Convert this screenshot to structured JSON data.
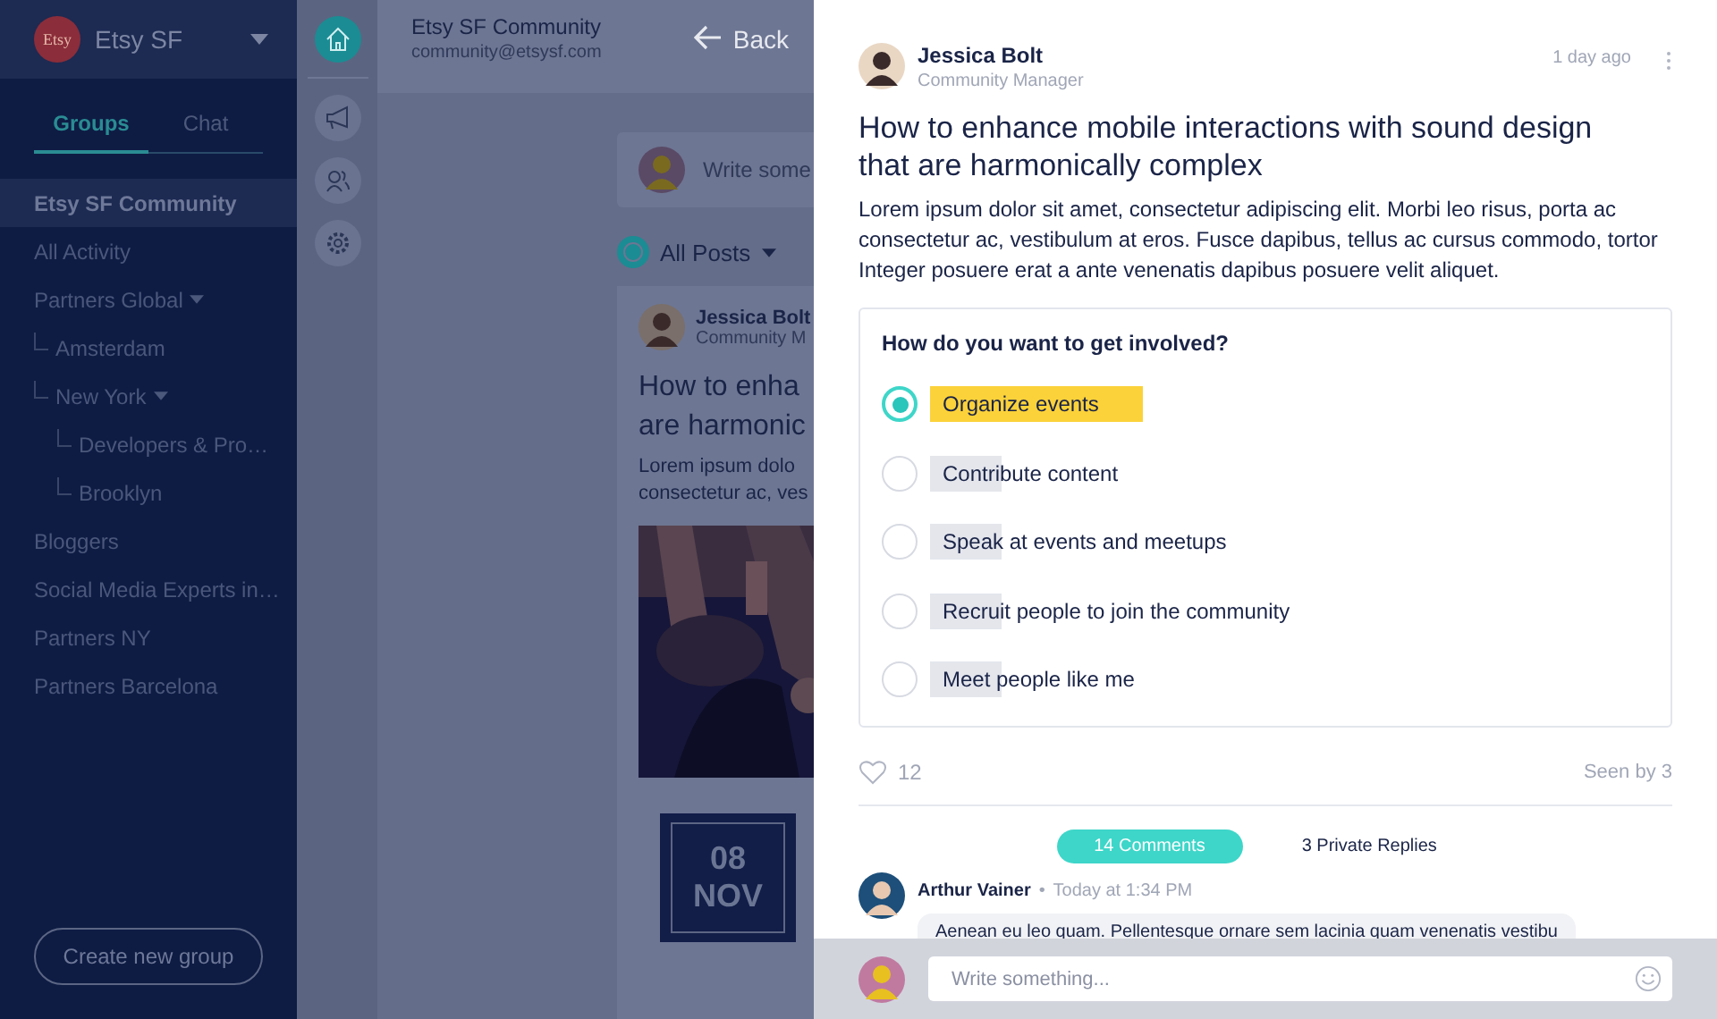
{
  "workspace": {
    "logo": "Etsy",
    "name": "Etsy SF"
  },
  "sidebar": {
    "tabs": [
      {
        "label": "Groups",
        "selected": true
      },
      {
        "label": "Chat",
        "selected": false
      }
    ],
    "items": [
      {
        "label": "Etsy SF Community",
        "selected": true
      },
      {
        "label": "All Activity",
        "selected": false
      },
      {
        "label": "Partners Global",
        "selected": false,
        "expanded": true,
        "children": [
          {
            "label": "Amsterdam",
            "selected": false
          },
          {
            "label": "New York",
            "selected": false,
            "expanded": true,
            "children": [
              {
                "label": "Developers & Pro…",
                "selected": false
              },
              {
                "label": "Brooklyn",
                "selected": false
              }
            ]
          }
        ]
      },
      {
        "label": "Bloggers",
        "selected": false
      },
      {
        "label": "Social Media Experts in…",
        "selected": false
      },
      {
        "label": "Partners NY",
        "selected": false
      },
      {
        "label": "Partners Barcelona",
        "selected": false
      }
    ],
    "create_button": "Create new group"
  },
  "rail": [
    {
      "kind": "home",
      "selected": true
    },
    {
      "kind": "megaphone",
      "selected": false
    },
    {
      "kind": "people",
      "selected": false
    },
    {
      "kind": "settings",
      "selected": false
    }
  ],
  "community": {
    "name": "Etsy SF Community",
    "email": "community@etsysf.com",
    "back": "Back",
    "composer_placeholder": "Write some",
    "filter": "All Posts",
    "post": {
      "author": "Jessica Bolt",
      "role": "Community M",
      "title": "How to enha\nare harmonic",
      "body": "Lorem ipsum dolo\nconsectetur ac, ves",
      "date_day": "08",
      "date_month": "NOV"
    }
  },
  "detail": {
    "author": "Jessica Bolt",
    "role": "Community Manager",
    "time": "1 day ago",
    "title": "How to enhance mobile interactions with sound design that are harmonically complex",
    "body": "Lorem ipsum dolor sit amet, consectetur adipiscing elit. Morbi leo risus, porta ac consectetur ac, vestibulum at eros. Fusce dapibus, tellus ac cursus commodo, tortor Integer posuere erat a ante venenatis dapibus posuere velit aliquet.",
    "poll": {
      "question": "How do you want to get involved?",
      "options": [
        {
          "label": "Organize events",
          "selected": true
        },
        {
          "label": "Contribute content",
          "selected": false
        },
        {
          "label": "Speak at events and meetups",
          "selected": false
        },
        {
          "label": "Recruit people to join the community",
          "selected": false
        },
        {
          "label": "Meet people like me",
          "selected": false
        }
      ]
    },
    "likes": "12",
    "seen": "Seen by 3",
    "tabs": [
      {
        "label": "14 Comments",
        "selected": true
      },
      {
        "label": "3 Private Replies",
        "selected": false
      }
    ],
    "comments": [
      {
        "author": "Arthur Vainer",
        "separator": "•",
        "time": "Today at 1:34 PM",
        "text": "Aenean eu leo quam. Pellentesque ornare sem lacinia quam venenatis vestibu"
      }
    ],
    "composer": {
      "placeholder": "Write something..."
    }
  }
}
